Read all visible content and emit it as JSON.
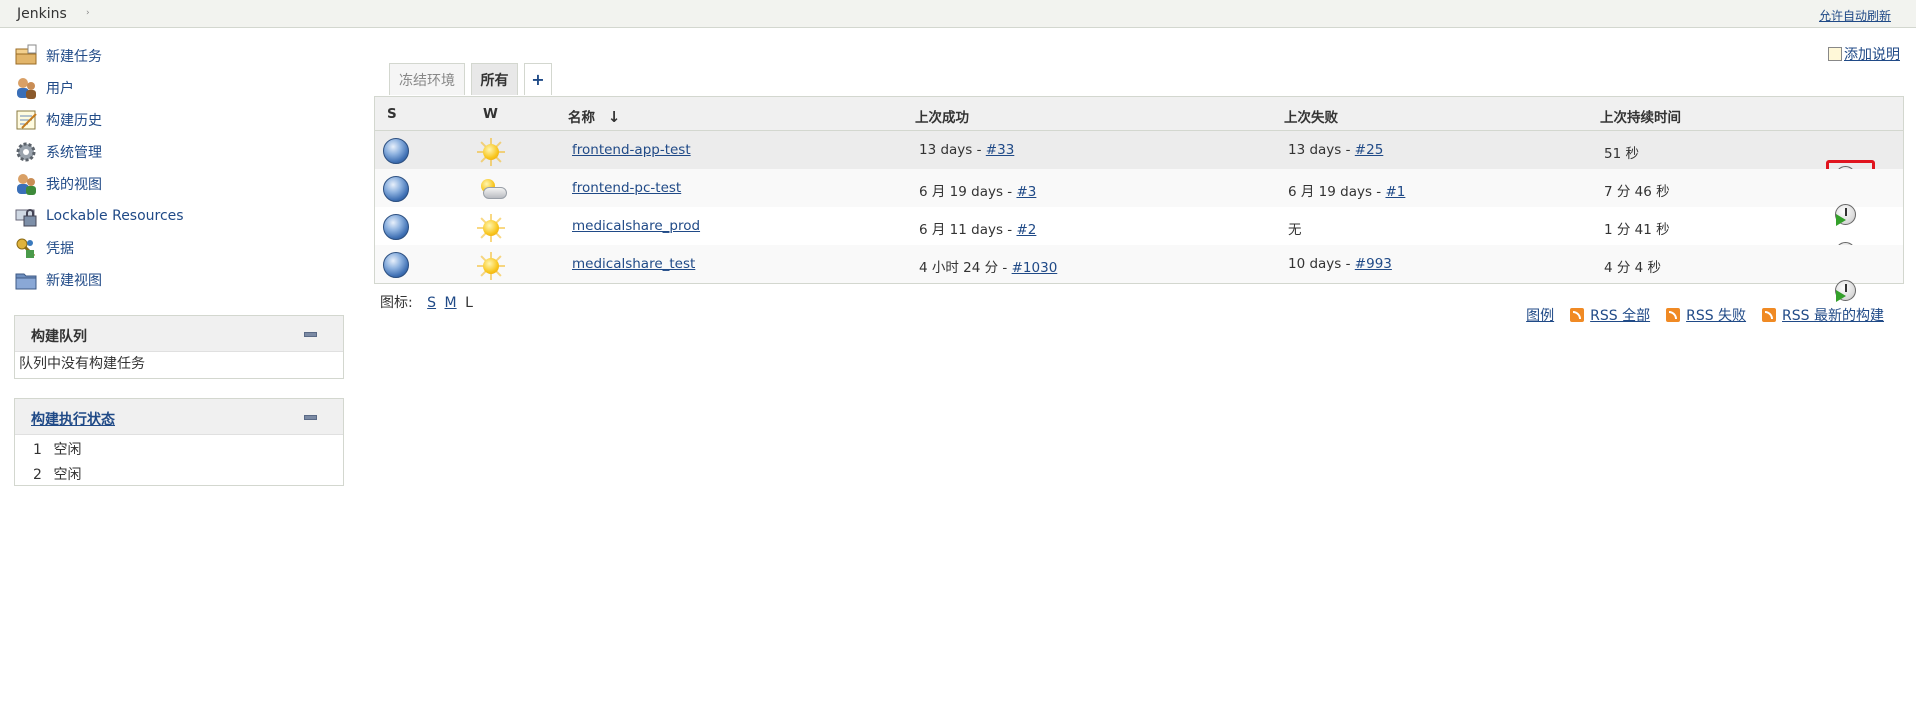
{
  "breadcrumb": {
    "root": "Jenkins",
    "arrow": "›",
    "autorefresh": "允许自动刷新"
  },
  "sidebar": {
    "tasks": [
      {
        "label": "新建任务",
        "icon": "new-item-icon"
      },
      {
        "label": "用户",
        "icon": "users-icon"
      },
      {
        "label": "构建历史",
        "icon": "build-history-icon"
      },
      {
        "label": "系统管理",
        "icon": "gear-icon"
      },
      {
        "label": "我的视图",
        "icon": "my-views-icon"
      },
      {
        "label": "Lockable Resources",
        "icon": "lock-resources-icon"
      },
      {
        "label": "凭据",
        "icon": "credentials-icon"
      },
      {
        "label": "新建视图",
        "icon": "folder-icon"
      }
    ],
    "queue": {
      "title": "构建队列",
      "empty": "队列中没有构建任务"
    },
    "executors": {
      "title": "构建执行状态",
      "items": [
        {
          "num": "1",
          "status": "空闲"
        },
        {
          "num": "2",
          "status": "空闲"
        }
      ]
    }
  },
  "tabs": {
    "inactive": "冻结环境",
    "active": "所有",
    "add": "+"
  },
  "add_description": "添加说明",
  "table": {
    "headers": {
      "s": "S",
      "w": "W",
      "name": "名称",
      "sort": "↓",
      "last_success": "上次成功",
      "last_failure": "上次失败",
      "last_duration": "上次持续时间"
    },
    "rows": [
      {
        "name": "frontend-app-test",
        "success_text": "13 days - ",
        "success_link": "#33",
        "failure_text": "13 days - ",
        "failure_link": "#25",
        "duration": "51 秒",
        "weather": "sunny"
      },
      {
        "name": "frontend-pc-test",
        "success_text": "6 月 19 days - ",
        "success_link": "#3",
        "failure_text": "6 月 19 days - ",
        "failure_link": "#1",
        "duration": "7 分 46 秒",
        "weather": "cloudy"
      },
      {
        "name": "medicalshare_prod",
        "success_text": "6 月 11 days - ",
        "success_link": "#2",
        "failure_text": "无",
        "failure_link": "",
        "duration": "1 分 41 秒",
        "weather": "sunny"
      },
      {
        "name": "medicalshare_test",
        "success_text": "4 小时 24 分 - ",
        "success_link": "#1030",
        "failure_text": "10 days - ",
        "failure_link": "#993",
        "duration": "4 分 4 秒",
        "weather": "sunny"
      }
    ]
  },
  "icon_size": {
    "label": "图标:",
    "s": "S",
    "m": "M",
    "l": "L"
  },
  "footer": {
    "legend": "图例",
    "rss_all": "RSS 全部",
    "rss_failed": "RSS 失败",
    "rss_latest": "RSS 最新的构建"
  },
  "colors": {
    "link": "#204a87",
    "highlight": "#e0141e"
  }
}
